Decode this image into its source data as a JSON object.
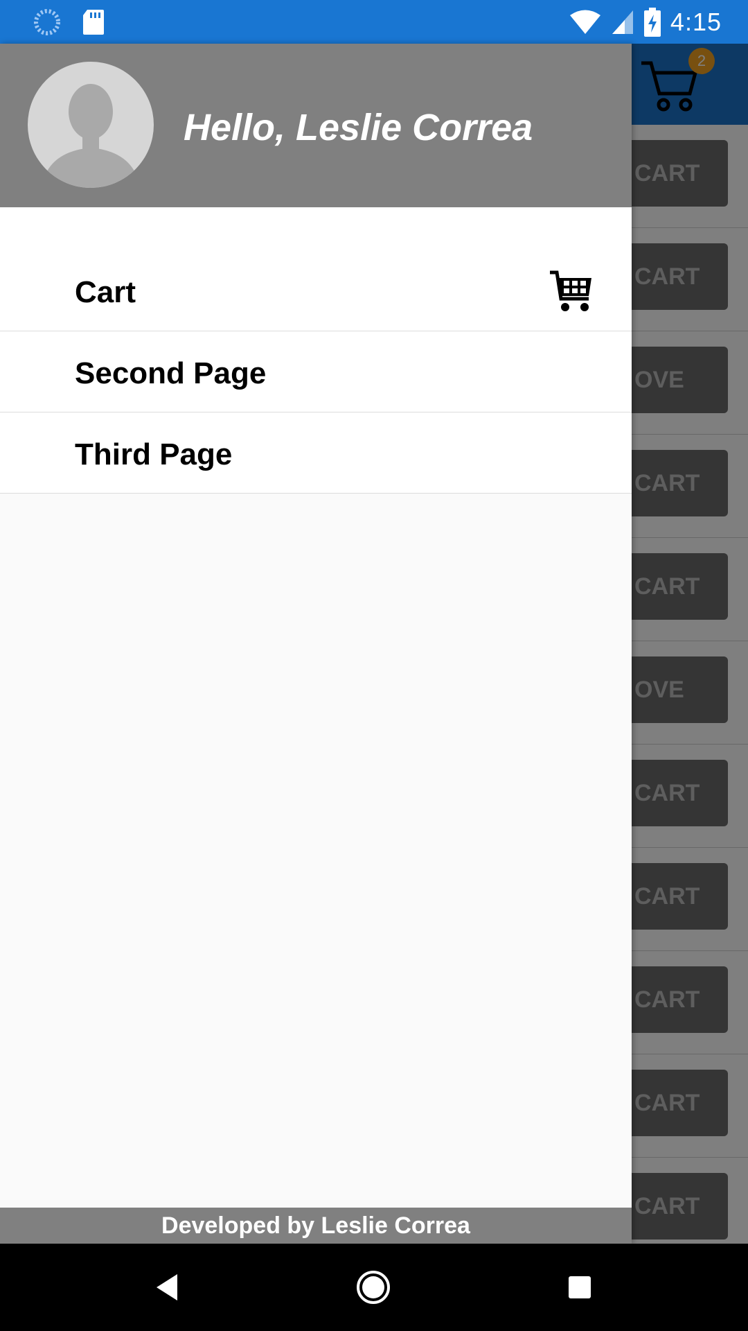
{
  "status_bar": {
    "time": "4:15",
    "icons": [
      "sync-icon",
      "sd-card-icon",
      "wifi-icon",
      "signal-icon",
      "battery-charging-icon"
    ]
  },
  "app": {
    "cart_badge_count": "2",
    "row_buttons": [
      "CART",
      "CART",
      "OVE",
      "CART",
      "CART",
      "OVE",
      "CART",
      "CART",
      "CART",
      "CART",
      "CART"
    ]
  },
  "drawer": {
    "greeting": "Hello, Leslie Correa",
    "menu_items": [
      {
        "label": "Cart",
        "icon": "shopping-cart-icon"
      },
      {
        "label": "Second Page"
      },
      {
        "label": "Third Page"
      }
    ],
    "footer": "Developed by Leslie Correa"
  },
  "colors": {
    "status_bar": "#1976d2",
    "drawer_header": "#808080",
    "drawer_footer": "#808080",
    "badge": "#f0a020"
  }
}
